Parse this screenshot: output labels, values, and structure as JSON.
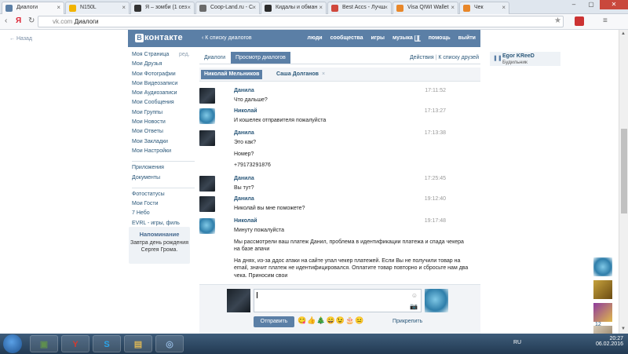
{
  "browser": {
    "tabs": [
      {
        "label": "Диалоги",
        "fav": "#5b7fa6",
        "active": true
      },
      {
        "label": "N150L",
        "fav": "#f2b400",
        "active": false
      },
      {
        "label": "Я – зомби (1 сез",
        "fav": "#333333",
        "active": false
      },
      {
        "label": "Coop-Land.ru - С",
        "fav": "#6b6b6b",
        "active": false
      },
      {
        "label": "Кидалы и обман",
        "fav": "#2b2b2b",
        "active": false
      },
      {
        "label": "Best Accs - Лучш",
        "fav": "#d0483c",
        "active": false
      },
      {
        "label": "Visa QIWI Wallet",
        "fav": "#e8872a",
        "active": false
      },
      {
        "label": "Чек",
        "fav": "#e8872a",
        "active": false
      }
    ],
    "url_domain": "vk.com",
    "url_title": "Диалоги"
  },
  "vk": {
    "back_link": "Назад",
    "logo_badge": "В",
    "logo_text": "контакте",
    "back_to_dialogs": "К списку диалогов",
    "nav": [
      "люди",
      "сообщества",
      "игры",
      "музыка",
      "помощь",
      "выйти"
    ],
    "pause_glyph": "❚❚",
    "left_menu_group1": [
      "Моя Страница",
      "Мои Друзья",
      "Мои Фотографии",
      "Мои Видеозаписи",
      "Мои Аудиозаписи",
      "Мои Сообщения",
      "Мои Группы",
      "Мои Новости",
      "Мои Ответы",
      "Мои Закладки",
      "Мои Настройки"
    ],
    "edit_label": "ред.",
    "left_menu_group2": [
      "Приложения",
      "Документы"
    ],
    "left_menu_group3": [
      "Фотостатусы",
      "Мои Гости",
      "7 Небо",
      "EVRL - игры, филь"
    ],
    "reminder": {
      "title": "Напоминание",
      "body": "Завтра день рождения Сергея Грома."
    },
    "tabs": {
      "dialogs": "Диалоги",
      "view": "Просмотр диалогов",
      "actions": "Действия",
      "to_friends": "К списку друзей",
      "divider": "|"
    },
    "open_dialogs": {
      "active": "Николай Мельников",
      "inactive": "Саша Долганов",
      "close": "×"
    },
    "messages": [
      {
        "author": "Данила",
        "ava": "d",
        "time": "17:11:52",
        "lines": [
          "Что дальше?"
        ]
      },
      {
        "author": "Николай",
        "ava": "n",
        "time": "17:13:27",
        "lines": [
          "И кошелек отправителя пожалуйста"
        ]
      },
      {
        "author": "Данила",
        "ava": "d",
        "time": "17:13:38",
        "lines": [
          "Это как?",
          "Номер?",
          "+79173291876"
        ]
      },
      {
        "author": "Данила",
        "ava": "d",
        "time": "17:25:45",
        "lines": [
          "Вы тут?"
        ]
      },
      {
        "author": "Данила",
        "ava": "d",
        "time": "19:12:40",
        "lines": [
          "Николай вы мне поможете?"
        ]
      },
      {
        "author": "Николай",
        "ava": "n",
        "time": "19:17:48",
        "lines": [
          "Минуту пожалуйста",
          "Мы рассмотрели ваш платеж Данил, проблема в идентификации платежа и спада чекера на базе апачи",
          "На днях, из-за ддос атаки на сайте упал чекер платежей. Если Вы не получили товар на email, значит платеж не идентифицировался. Оплатите товар повторно и сбросьте нам два чека. Приносим свои"
        ]
      }
    ],
    "composer": {
      "send": "Отправить",
      "attach": "Прикрепить",
      "emojis": "😋👍🎄😄😉🎂😐",
      "smile_glyph": "☺",
      "camera_glyph": "📷"
    },
    "right_widget": {
      "name": "Egor KReeD",
      "status": "Будильник",
      "icon": "❚❚"
    },
    "friends_count": "12"
  },
  "taskbar": {
    "items": [
      {
        "label": "▣",
        "color": "#5f8f4e"
      },
      {
        "label": "Y",
        "color": "#d43a2f"
      },
      {
        "label": "S",
        "color": "#2aa3e8"
      },
      {
        "label": "▤",
        "color": "#d9b557"
      },
      {
        "label": "◎",
        "color": "#8fb3d9"
      }
    ],
    "lang": "RU",
    "time": "20:27",
    "date": "06.02.2016"
  }
}
